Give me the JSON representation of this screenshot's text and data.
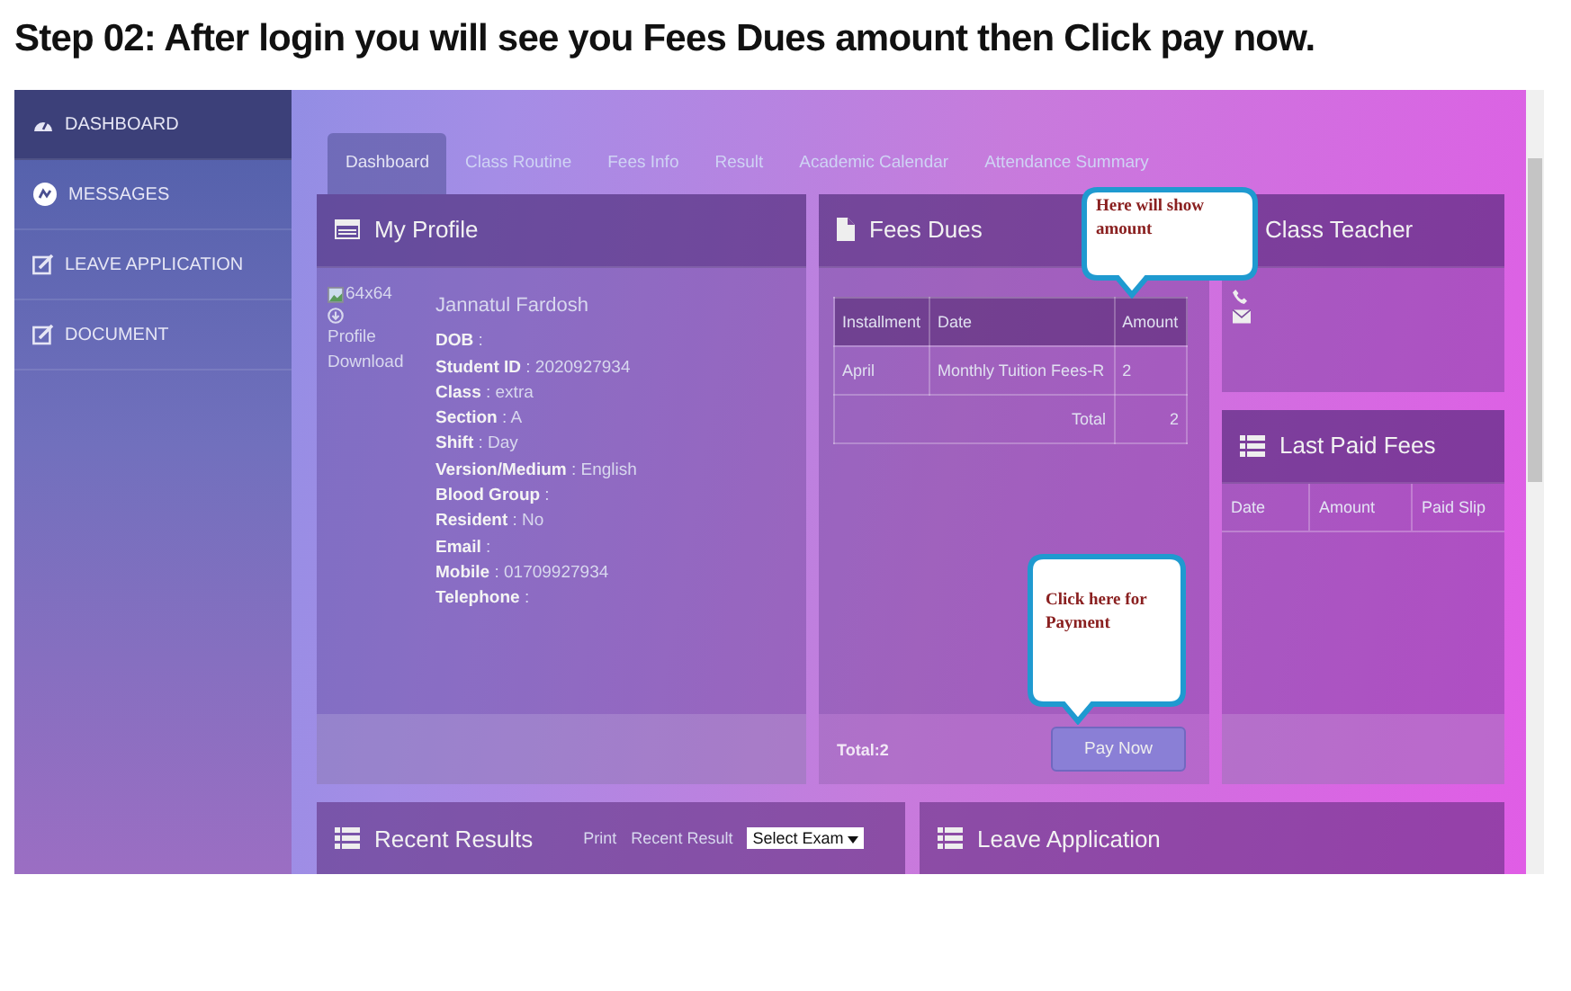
{
  "heading": "Step 02: After login you will see you Fees Dues amount then Click pay now.",
  "sidebar": {
    "items": [
      {
        "label": "DASHBOARD",
        "kind": "dashboard",
        "selected": true
      },
      {
        "label": "MESSAGES",
        "kind": "messages",
        "selected": false
      },
      {
        "label": "LEAVE APPLICATION",
        "kind": "edit",
        "selected": false
      },
      {
        "label": "DOCUMENT",
        "kind": "edit",
        "selected": false
      }
    ]
  },
  "tabs": [
    {
      "label": "Dashboard",
      "selected": true
    },
    {
      "label": "Class Routine",
      "selected": false
    },
    {
      "label": "Fees Info",
      "selected": false
    },
    {
      "label": "Result",
      "selected": false
    },
    {
      "label": "Academic Calendar",
      "selected": false
    },
    {
      "label": "Attendance Summary",
      "selected": false
    }
  ],
  "profile": {
    "title": "My Profile",
    "image_alt": "64x64",
    "download_label": "Profile Download",
    "name": "Jannatul Fardosh",
    "fields": [
      {
        "label": "DOB",
        "rest": ":"
      },
      {
        "label": "Student ID",
        "rest": ": 2020927934"
      },
      {
        "label": "Class",
        "rest": ": extra"
      },
      {
        "label": "Section",
        "rest": ": A"
      },
      {
        "label": "Shift",
        "rest": ": Day"
      },
      {
        "label": "Version/Medium",
        "rest": ": English"
      },
      {
        "label": "Blood Group",
        "rest": ":"
      },
      {
        "label": "Resident",
        "rest": ": No"
      },
      {
        "label": "Email",
        "rest": ":"
      },
      {
        "label": "Mobile",
        "rest": ": 01709927934"
      },
      {
        "label": "Telephone",
        "rest": ":"
      }
    ]
  },
  "fees_dues": {
    "title": "Fees Dues",
    "columns": [
      "Installment",
      "Date",
      "Amount"
    ],
    "rows": [
      [
        "April",
        "Monthly Tuition Fees-R",
        "2"
      ]
    ],
    "total_label": "Total",
    "total_value": "2",
    "footer_total": "Total:2",
    "pay_button": "Pay Now"
  },
  "class_teacher": {
    "title": "Class Teacher"
  },
  "last_paid_fees": {
    "title": "Last Paid Fees",
    "columns": [
      "Date",
      "Amount",
      "Paid Slip"
    ]
  },
  "recent_results": {
    "title": "Recent Results",
    "print_label": "Print",
    "recent_label": "Recent Result",
    "select": "Select Exam"
  },
  "leave_application": {
    "title": "Leave Application"
  },
  "callouts": [
    {
      "text": "Here will show amount",
      "kind": "top"
    },
    {
      "text": "Click here for Payment",
      "kind": "tall"
    }
  ]
}
